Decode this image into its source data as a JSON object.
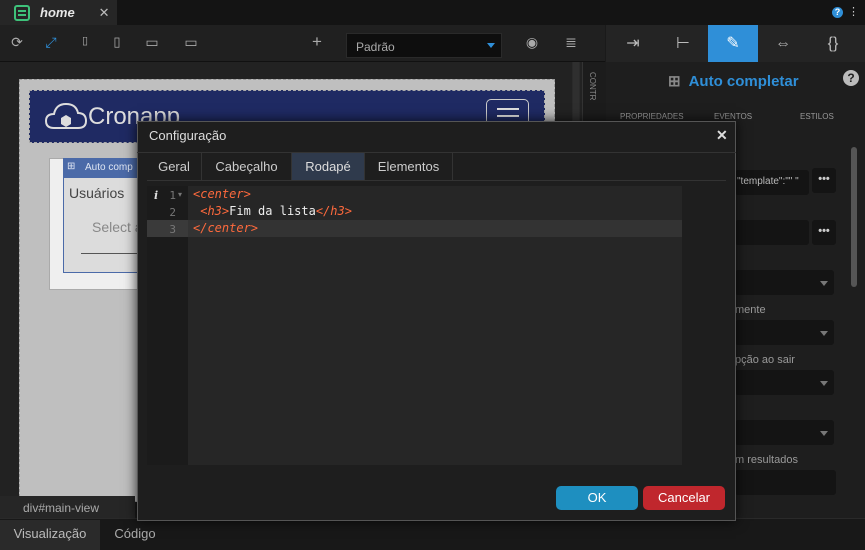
{
  "tabs": {
    "home": "home",
    "close": "✕"
  },
  "toolbar": {
    "device_select": "Padrão",
    "add": "+"
  },
  "right_panel": {
    "title": "Auto completar",
    "tabs": [
      "PROPRIEDADES",
      "EVENTOS",
      "ESTILOS"
    ],
    "field_template": "\"template\":\"\" \"",
    "labels": [
      "mente",
      "pção ao sair",
      "m resultados"
    ],
    "more": "•••",
    "help": "?"
  },
  "canvas": {
    "logo": "Cronapp",
    "card_header": "Auto comp",
    "card_label": "Usuários",
    "card_select": "Select a",
    "side_tab": "CONTR"
  },
  "bottom": {
    "breadcrumb": "div#main-view",
    "tab_visual": "Visualização",
    "tab_code": "Código"
  },
  "modal": {
    "title": "Configuração",
    "close": "✕",
    "tabs": [
      "Geral",
      "Cabeçalho",
      "Rodapé",
      "Elementos"
    ],
    "active_tab": "Rodapé",
    "code": {
      "line1_tag": "<center>",
      "line2_open": "<h3>",
      "line2_text": "Fim da lista",
      "line2_close": "</h3>",
      "line3_tag": "</center>"
    },
    "line_numbers": [
      "1",
      "2",
      "3"
    ],
    "ok": "OK",
    "cancel": "Cancelar"
  },
  "colors": {
    "accent": "#2f8fd8",
    "ok": "#1e8fc0",
    "cancel": "#c0272d",
    "tag": "#ff6a3d",
    "navbar": "#1f2a63"
  }
}
